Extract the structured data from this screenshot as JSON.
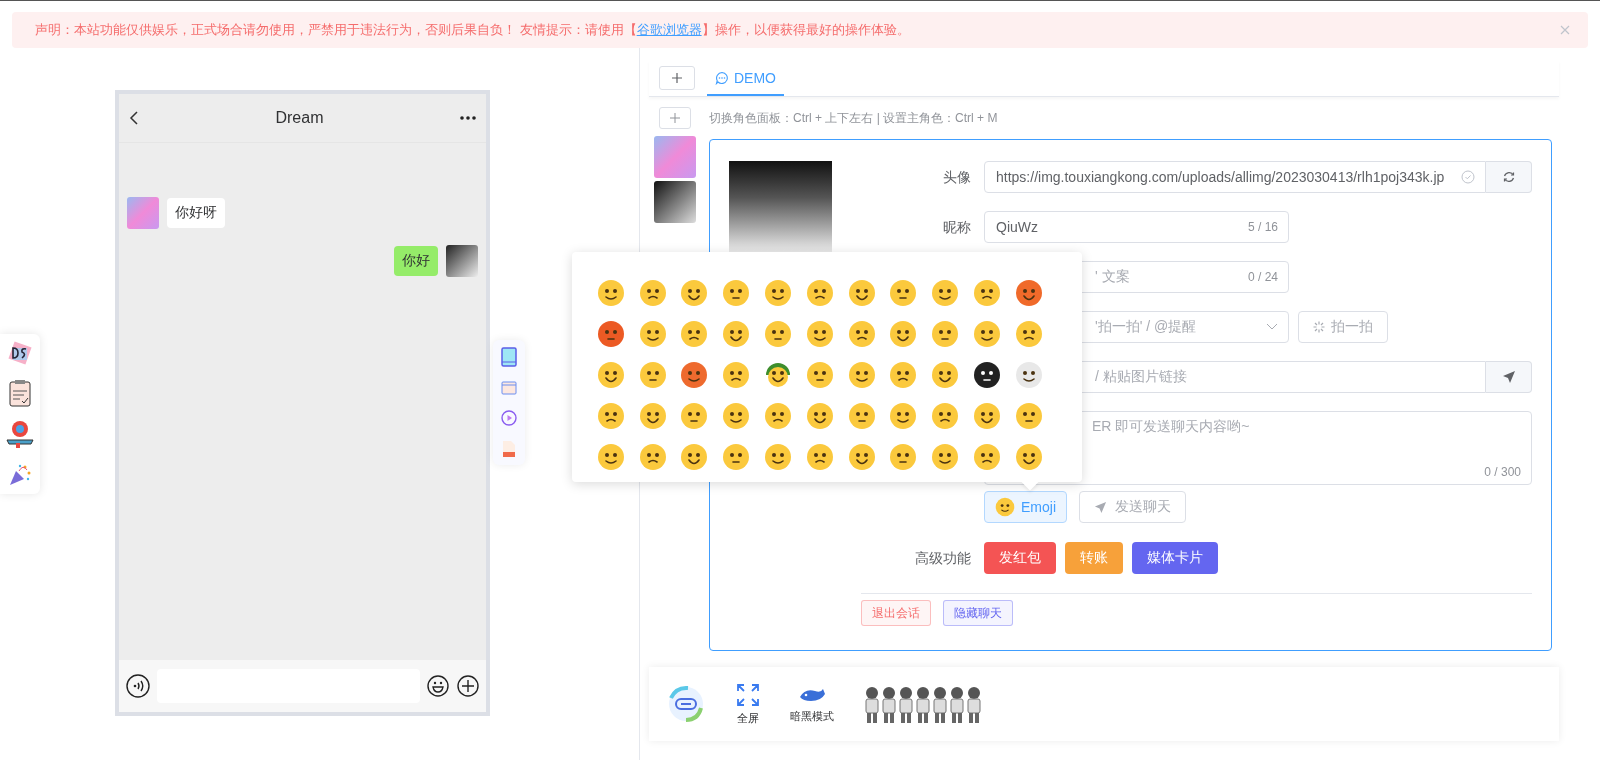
{
  "notice": {
    "text": "声明：本站功能仅供娱乐，正式场合请勿使用，严禁用于违法行为，否则后果自负！ 友情提示：请使用【",
    "link": "谷歌浏览器",
    "text_after": "】操作，以便获得最好的操作体验。"
  },
  "phone": {
    "title": "Dream",
    "messages": [
      {
        "kind": "received",
        "text": "你好呀"
      },
      {
        "kind": "sent",
        "text": "你好"
      }
    ]
  },
  "tabs": [
    {
      "label": "DEMO",
      "selected": true
    }
  ],
  "hint": "切换角色面板：Ctrl + 上下左右 | 设置主角色：Ctrl + M",
  "form": {
    "rows": [
      {
        "kind": "url",
        "label": "头像",
        "value": "https://img.touxiangkong.com/uploads/allimg/2023030413/rlh1poj343k.jp"
      },
      {
        "kind": "count",
        "label": "昵称",
        "value": "QiuWz",
        "count": "5 / 16"
      },
      {
        "kind": "count",
        "placeholder": "' 文案",
        "count": "0 / 24"
      },
      {
        "kind": "select",
        "placeholder": "'拍一拍' / @提醒",
        "button": "拍一拍"
      },
      {
        "kind": "send",
        "placeholder": "/ 粘贴图片链接"
      },
      {
        "kind": "textarea",
        "placeholder": "ER 即可发送聊天内容哟~",
        "count": "0 / 300"
      },
      {
        "kind": "actions",
        "emoji_button": "Emoji",
        "send_button": "发送聊天"
      },
      {
        "kind": "advanced",
        "label": "高级功能",
        "buttons": [
          {
            "label": "发红包",
            "color": "#f45454"
          },
          {
            "label": "转账",
            "color": "#f7a13a"
          },
          {
            "label": "媒体卡片",
            "color": "#6466f0"
          }
        ]
      }
    ]
  },
  "tags": [
    {
      "label": "退出会话",
      "color": "#f56c6c"
    },
    {
      "label": "隐藏聊天",
      "color": "#6466f0"
    }
  ],
  "bottom_bar": [
    {
      "kind": "fullscreen",
      "label": "全屏"
    },
    {
      "kind": "dark",
      "label": "暗黑模式"
    }
  ]
}
